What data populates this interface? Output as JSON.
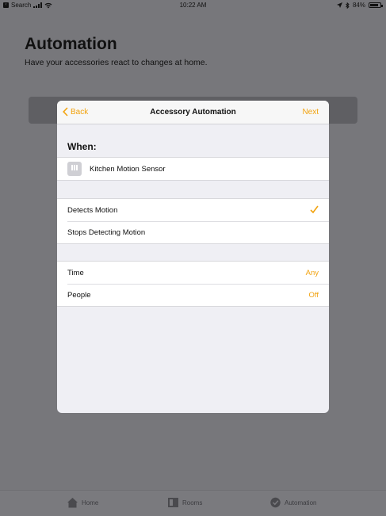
{
  "status_bar": {
    "back_app": "Search",
    "time": "10:22 AM",
    "battery": "84%",
    "battery_level": 0.84
  },
  "background": {
    "title": "Automation",
    "subtitle": "Have your accessories react to changes at home."
  },
  "tab_bar": {
    "tabs": [
      {
        "label": "Home",
        "icon": "house-icon"
      },
      {
        "label": "Rooms",
        "icon": "rooms-icon"
      },
      {
        "label": "Automation",
        "icon": "automation-icon"
      }
    ]
  },
  "modal": {
    "nav": {
      "back_label": "Back",
      "title": "Accessory Automation",
      "next_label": "Next"
    },
    "when_header": "When:",
    "accessory": {
      "name": "Kitchen Motion Sensor",
      "icon": "motion-sensor-icon"
    },
    "triggers": [
      {
        "label": "Detects Motion",
        "selected": true
      },
      {
        "label": "Stops Detecting Motion",
        "selected": false
      }
    ],
    "conditions": [
      {
        "label": "Time",
        "value": "Any"
      },
      {
        "label": "People",
        "value": "Off"
      }
    ]
  },
  "colors": {
    "accent": "#f2a30f",
    "dim_background": "#77777b",
    "sheet": "#efeff4"
  }
}
